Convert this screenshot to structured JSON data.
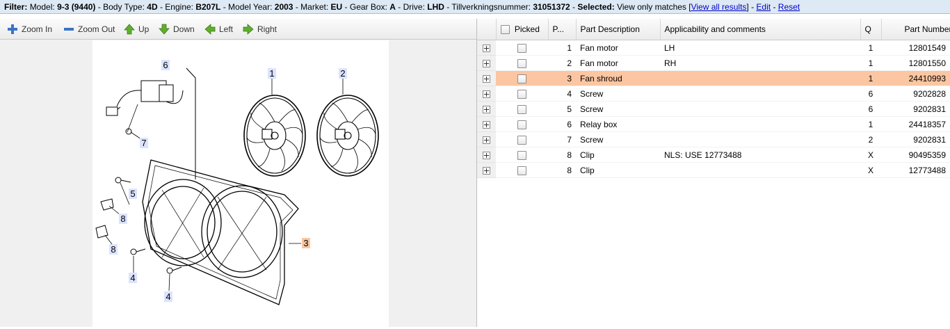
{
  "filter": {
    "label": "Filter:",
    "parts": [
      {
        "k": "Model:",
        "v": "9-3 (9440)"
      },
      {
        "k": "Body Type:",
        "v": "4D"
      },
      {
        "k": "Engine:",
        "v": "B207L"
      },
      {
        "k": "Model Year:",
        "v": "2003"
      },
      {
        "k": "Market:",
        "v": "EU"
      },
      {
        "k": "Gear Box:",
        "v": "A"
      },
      {
        "k": "Drive:",
        "v": "LHD"
      },
      {
        "k": "Tillverkningsnummer:",
        "v": "31051372"
      }
    ],
    "selected_label": "Selected:",
    "selected_value": "View only matches [",
    "view_all": "View all results",
    "close_bracket": "]",
    "edit": "Edit",
    "reset": "Reset"
  },
  "toolbar": {
    "zoom_in": "Zoom In",
    "zoom_out": "Zoom Out",
    "up": "Up",
    "down": "Down",
    "left": "Left",
    "right": "Right"
  },
  "diagram": {
    "callouts": [
      "1",
      "2",
      "3",
      "4",
      "4",
      "5",
      "6",
      "7",
      "8",
      "8"
    ]
  },
  "grid": {
    "headers": {
      "picked": "Picked",
      "pos": "P...",
      "desc": "Part Description",
      "appl": "Applicability and comments",
      "qty": "Q",
      "partno": "Part Number"
    },
    "rows": [
      {
        "pos": "1",
        "desc": "Fan motor",
        "appl": "LH",
        "qty": "1",
        "partno": "12801549"
      },
      {
        "pos": "2",
        "desc": "Fan motor",
        "appl": "RH",
        "qty": "1",
        "partno": "12801550"
      },
      {
        "pos": "3",
        "desc": "Fan shroud",
        "appl": "",
        "qty": "1",
        "partno": "24410993"
      },
      {
        "pos": "4",
        "desc": "Screw",
        "appl": "",
        "qty": "6",
        "partno": "9202828"
      },
      {
        "pos": "5",
        "desc": "Screw",
        "appl": "",
        "qty": "6",
        "partno": "9202831"
      },
      {
        "pos": "6",
        "desc": "Relay box",
        "appl": "",
        "qty": "1",
        "partno": "24418357"
      },
      {
        "pos": "7",
        "desc": "Screw",
        "appl": "",
        "qty": "2",
        "partno": "9202831"
      },
      {
        "pos": "8",
        "desc": "Clip",
        "appl": "NLS: USE 12773488",
        "qty": "X",
        "partno": "90495359"
      },
      {
        "pos": "8",
        "desc": "Clip",
        "appl": "",
        "qty": "X",
        "partno": "12773488"
      }
    ],
    "highlight_color": "#fbc6a1"
  }
}
